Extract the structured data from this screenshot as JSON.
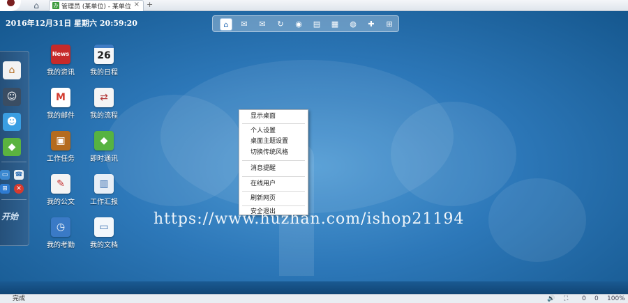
{
  "browser": {
    "tab_title": "管理员 (某单位) - 某单位",
    "tab_favicon": "办",
    "home_icon": "⌂",
    "close_icon": "×",
    "new_tab_icon": "+",
    "status_text": "完成",
    "zoom": "100%",
    "status_icons": [
      "🔊",
      "⛶",
      "0",
      "0"
    ]
  },
  "desktop": {
    "datetime": "2016年12月31日 星期六 20:59:20",
    "dock": [
      {
        "name": "home-icon",
        "glyph": "⌂",
        "color": "#ffffff"
      },
      {
        "name": "mail-icon",
        "glyph": "✉",
        "color": "#e8eef5"
      },
      {
        "name": "envelope-icon",
        "glyph": "✉",
        "color": "#f0c419"
      },
      {
        "name": "refresh-icon",
        "glyph": "↻",
        "color": "#2a7fd0"
      },
      {
        "name": "rss-icon",
        "glyph": "◉",
        "color": "#ee7a1c"
      },
      {
        "name": "notepad-icon",
        "glyph": "▤",
        "color": "#f5f0d5"
      },
      {
        "name": "calendar-icon",
        "glyph": "▦",
        "color": "#dce8f4"
      },
      {
        "name": "globe-icon",
        "glyph": "◍",
        "color": "#3c8fd5"
      },
      {
        "name": "lifebuoy-icon",
        "glyph": "✚",
        "color": "#e24c2e"
      },
      {
        "name": "grid-icon",
        "glyph": "⊞",
        "color": "#5d7f9f"
      }
    ],
    "sidebar_text": "开始",
    "apps": [
      {
        "label": "我的资讯",
        "icon": "News",
        "color": "#c62a2a"
      },
      {
        "label": "我的日程",
        "icon": "26",
        "color": "#f4f6f8"
      },
      {
        "label": "我的邮件",
        "icon": "M",
        "color": "#ffffff"
      },
      {
        "label": "我的流程",
        "icon": "⇄",
        "color": "#f4f4f4"
      },
      {
        "label": "工作任务",
        "icon": "▣",
        "color": "#b46b1e"
      },
      {
        "label": "即时通讯",
        "icon": "◆",
        "color": "#56b341"
      },
      {
        "label": "我的公文",
        "icon": "✎",
        "color": "#f3f3f3"
      },
      {
        "label": "工作汇报",
        "icon": "▥",
        "color": "#e7eef6"
      },
      {
        "label": "我的考勤",
        "icon": "◷",
        "color": "#3a7ac6"
      },
      {
        "label": "我的文档",
        "icon": "▭",
        "color": "#f3f7fb"
      }
    ],
    "context_menu": [
      "显示桌面",
      "个人设置",
      "桌面主题设置",
      "切换传统风格",
      "消息提醒",
      "在线用户",
      "刷新网页",
      "安全退出"
    ],
    "watermark": "https://www.huzhan.com/ishop21194"
  }
}
